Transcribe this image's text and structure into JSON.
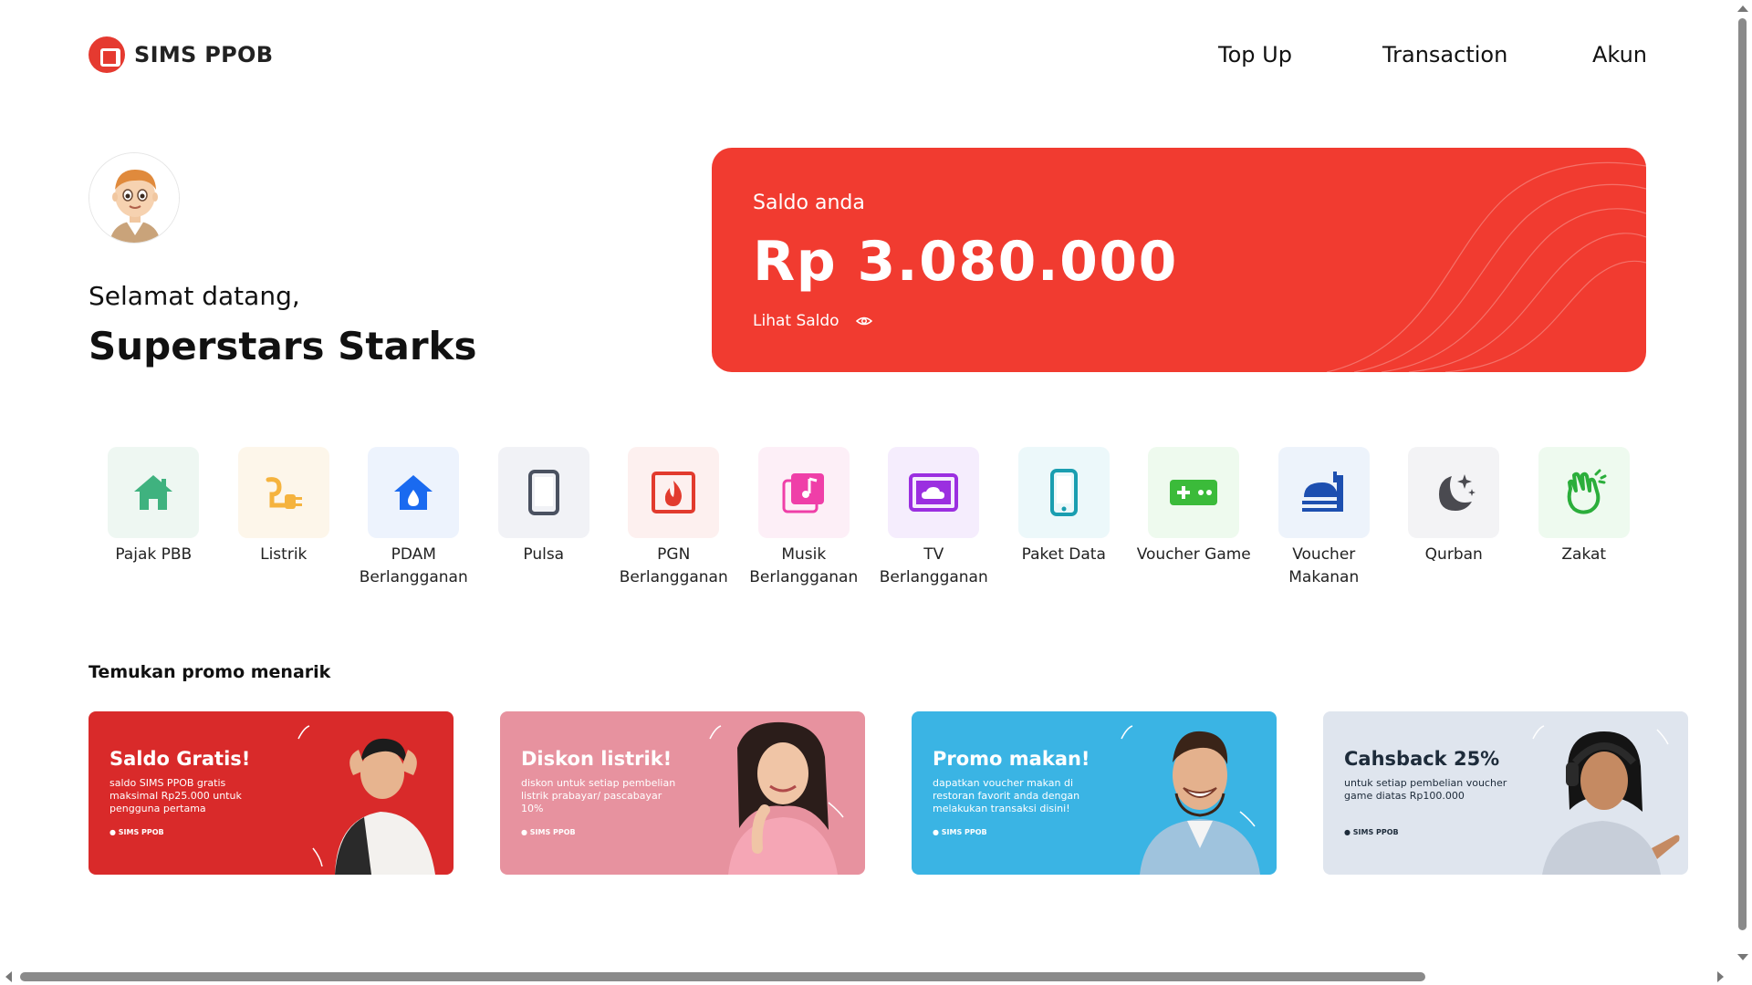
{
  "header": {
    "brand": "SIMS PPOB",
    "nav": [
      {
        "label": "Top Up"
      },
      {
        "label": "Transaction"
      },
      {
        "label": "Akun"
      }
    ]
  },
  "profile": {
    "greeting": "Selamat datang,",
    "name": "Superstars Starks"
  },
  "balance": {
    "label": "Saldo anda",
    "amount": "Rp 3.080.000",
    "toggle_label": "Lihat Saldo",
    "card_color": "#f13b30"
  },
  "services": [
    {
      "label": "Pajak PBB",
      "icon": "house-icon",
      "color": "#3fb27f",
      "bg": "#eef7f2"
    },
    {
      "label": "Listrik",
      "icon": "plug-icon",
      "color": "#f5b33e",
      "bg": "#fdf6ea"
    },
    {
      "label": "PDAM Berlangganan",
      "icon": "water-drop-house-icon",
      "color": "#1a6af0",
      "bg": "#edf3fd"
    },
    {
      "label": "Pulsa",
      "icon": "phone-icon",
      "color": "#4a5160",
      "bg": "#f1f2f6"
    },
    {
      "label": "PGN Berlangganan",
      "icon": "flame-icon",
      "color": "#e23b2e",
      "bg": "#fdf0ef"
    },
    {
      "label": "Musik Berlangganan",
      "icon": "music-icon",
      "color": "#ef3fa8",
      "bg": "#fdeff7"
    },
    {
      "label": "TV Berlangganan",
      "icon": "tv-cloud-icon",
      "color": "#9b2fe0",
      "bg": "#f5edfd"
    },
    {
      "label": "Paket Data",
      "icon": "smartphone-icon",
      "color": "#1a9eb0",
      "bg": "#ecf8fa"
    },
    {
      "label": "Voucher Game",
      "icon": "gamepad-icon",
      "color": "#3bbb3a",
      "bg": "#eefaee"
    },
    {
      "label": "Voucher Makanan",
      "icon": "food-cloche-icon",
      "color": "#1d4fb0",
      "bg": "#edf3fb"
    },
    {
      "label": "Qurban",
      "icon": "moon-star-icon",
      "color": "#4a4a50",
      "bg": "#f3f3f5"
    },
    {
      "label": "Zakat",
      "icon": "hand-icon",
      "color": "#2bae3b",
      "bg": "#eefaef"
    }
  ],
  "promo": {
    "title": "Temukan promo menarik",
    "items": [
      {
        "title": "Saldo Gratis!",
        "desc": "saldo SIMS PPOB gratis maksimal Rp25.000 untuk pengguna pertama",
        "brand": "SIMS PPOB",
        "bg": "#d92a2a",
        "text": "#ffffff"
      },
      {
        "title": "Diskon listrik!",
        "desc": "diskon untuk setiap pembelian listrik prabayar/ pascabayar 10%",
        "brand": "SIMS PPOB",
        "bg": "#e7929f",
        "text": "#ffffff"
      },
      {
        "title": "Promo makan!",
        "desc": "dapatkan voucher makan di restoran favorit anda dengan melakukan transaksi disini!",
        "brand": "SIMS PPOB",
        "bg": "#3ab4e4",
        "text": "#ffffff"
      },
      {
        "title": "Cahsback 25%",
        "desc": "untuk setiap pembelian voucher game diatas Rp100.000",
        "brand": "SIMS PPOB",
        "bg": "#dfe5ee",
        "text": "#1d2b3a"
      }
    ]
  }
}
